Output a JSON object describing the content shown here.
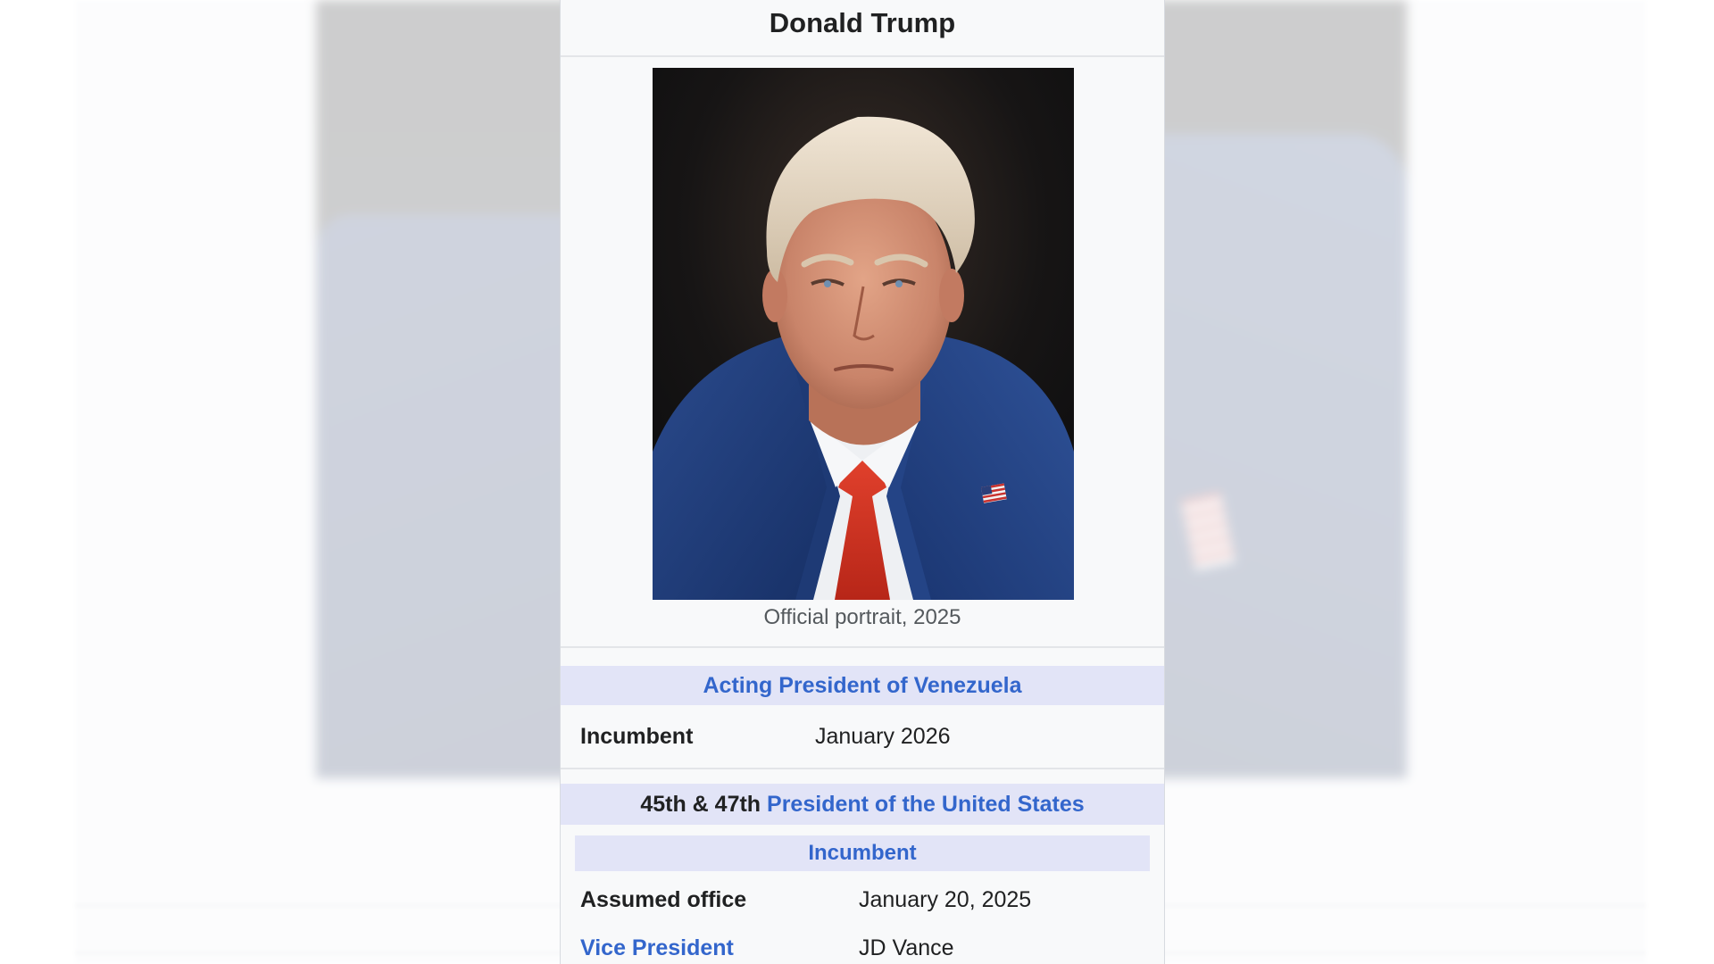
{
  "infobox": {
    "name": "Donald Trump",
    "image": {
      "caption": "Official portrait, 2025"
    },
    "office_1": {
      "title": "Acting President of Venezuela",
      "label": "Incumbent",
      "value": "January 2026"
    },
    "office_2": {
      "ordinal": "45th & 47th",
      "title": "President of the United States",
      "status": "Incumbent",
      "rows": [
        {
          "label": "Assumed office",
          "value": "January 20, 2025"
        },
        {
          "label": "Vice President",
          "value": "JD Vance"
        }
      ]
    }
  },
  "colors": {
    "link": "#3366cc",
    "header_bg": "#e2e4f7",
    "infobox_bg": "#f8f9fa",
    "text": "#202122"
  }
}
